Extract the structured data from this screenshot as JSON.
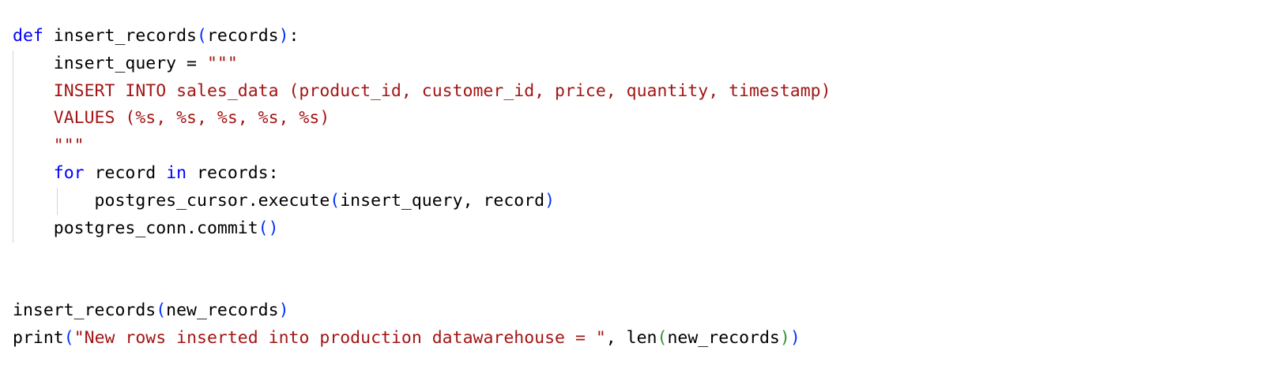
{
  "editor": {
    "language": "python",
    "colors": {
      "background": "#ffffff",
      "keyword": "#0000ff",
      "string": "#a31515",
      "bracket_level1": "#0431fa",
      "bracket_level2": "#319331",
      "text": "#000000",
      "indent_guide": "#d6d6d6"
    },
    "lines": [
      {
        "tokens": [
          {
            "t": "def",
            "c": "kw"
          },
          {
            "t": " insert_records",
            "c": "plain"
          },
          {
            "t": "(",
            "c": "br1"
          },
          {
            "t": "records",
            "c": "plain"
          },
          {
            "t": ")",
            "c": "br1"
          },
          {
            "t": ":",
            "c": "plain"
          }
        ]
      },
      {
        "tokens": [
          {
            "t": "    insert_query = ",
            "c": "plain"
          },
          {
            "t": "\"\"\"",
            "c": "str"
          }
        ]
      },
      {
        "tokens": [
          {
            "t": "    INSERT INTO sales_data (product_id, customer_id, price, quantity, timestamp)",
            "c": "str"
          }
        ]
      },
      {
        "tokens": [
          {
            "t": "    VALUES (%s, %s, %s, %s, %s)",
            "c": "str"
          }
        ]
      },
      {
        "tokens": [
          {
            "t": "    \"\"\"",
            "c": "str"
          }
        ]
      },
      {
        "tokens": [
          {
            "t": "    ",
            "c": "plain"
          },
          {
            "t": "for",
            "c": "kw"
          },
          {
            "t": " record ",
            "c": "plain"
          },
          {
            "t": "in",
            "c": "kw"
          },
          {
            "t": " records:",
            "c": "plain"
          }
        ]
      },
      {
        "tokens": [
          {
            "t": "        postgres_cursor.execute",
            "c": "plain"
          },
          {
            "t": "(",
            "c": "br1"
          },
          {
            "t": "insert_query, record",
            "c": "plain"
          },
          {
            "t": ")",
            "c": "br1"
          }
        ]
      },
      {
        "tokens": [
          {
            "t": "    postgres_conn.commit",
            "c": "plain"
          },
          {
            "t": "()",
            "c": "br1"
          }
        ]
      },
      {
        "tokens": []
      },
      {
        "tokens": []
      },
      {
        "tokens": [
          {
            "t": "insert_records",
            "c": "plain"
          },
          {
            "t": "(",
            "c": "br1"
          },
          {
            "t": "new_records",
            "c": "plain"
          },
          {
            "t": ")",
            "c": "br1"
          }
        ]
      },
      {
        "tokens": [
          {
            "t": "print",
            "c": "plain"
          },
          {
            "t": "(",
            "c": "br1"
          },
          {
            "t": "\"New rows inserted into production datawarehouse = \"",
            "c": "str"
          },
          {
            "t": ", len",
            "c": "plain"
          },
          {
            "t": "(",
            "c": "br2"
          },
          {
            "t": "new_records",
            "c": "plain"
          },
          {
            "t": ")",
            "c": "br2"
          },
          {
            "t": ")",
            "c": "br1"
          }
        ]
      }
    ]
  }
}
